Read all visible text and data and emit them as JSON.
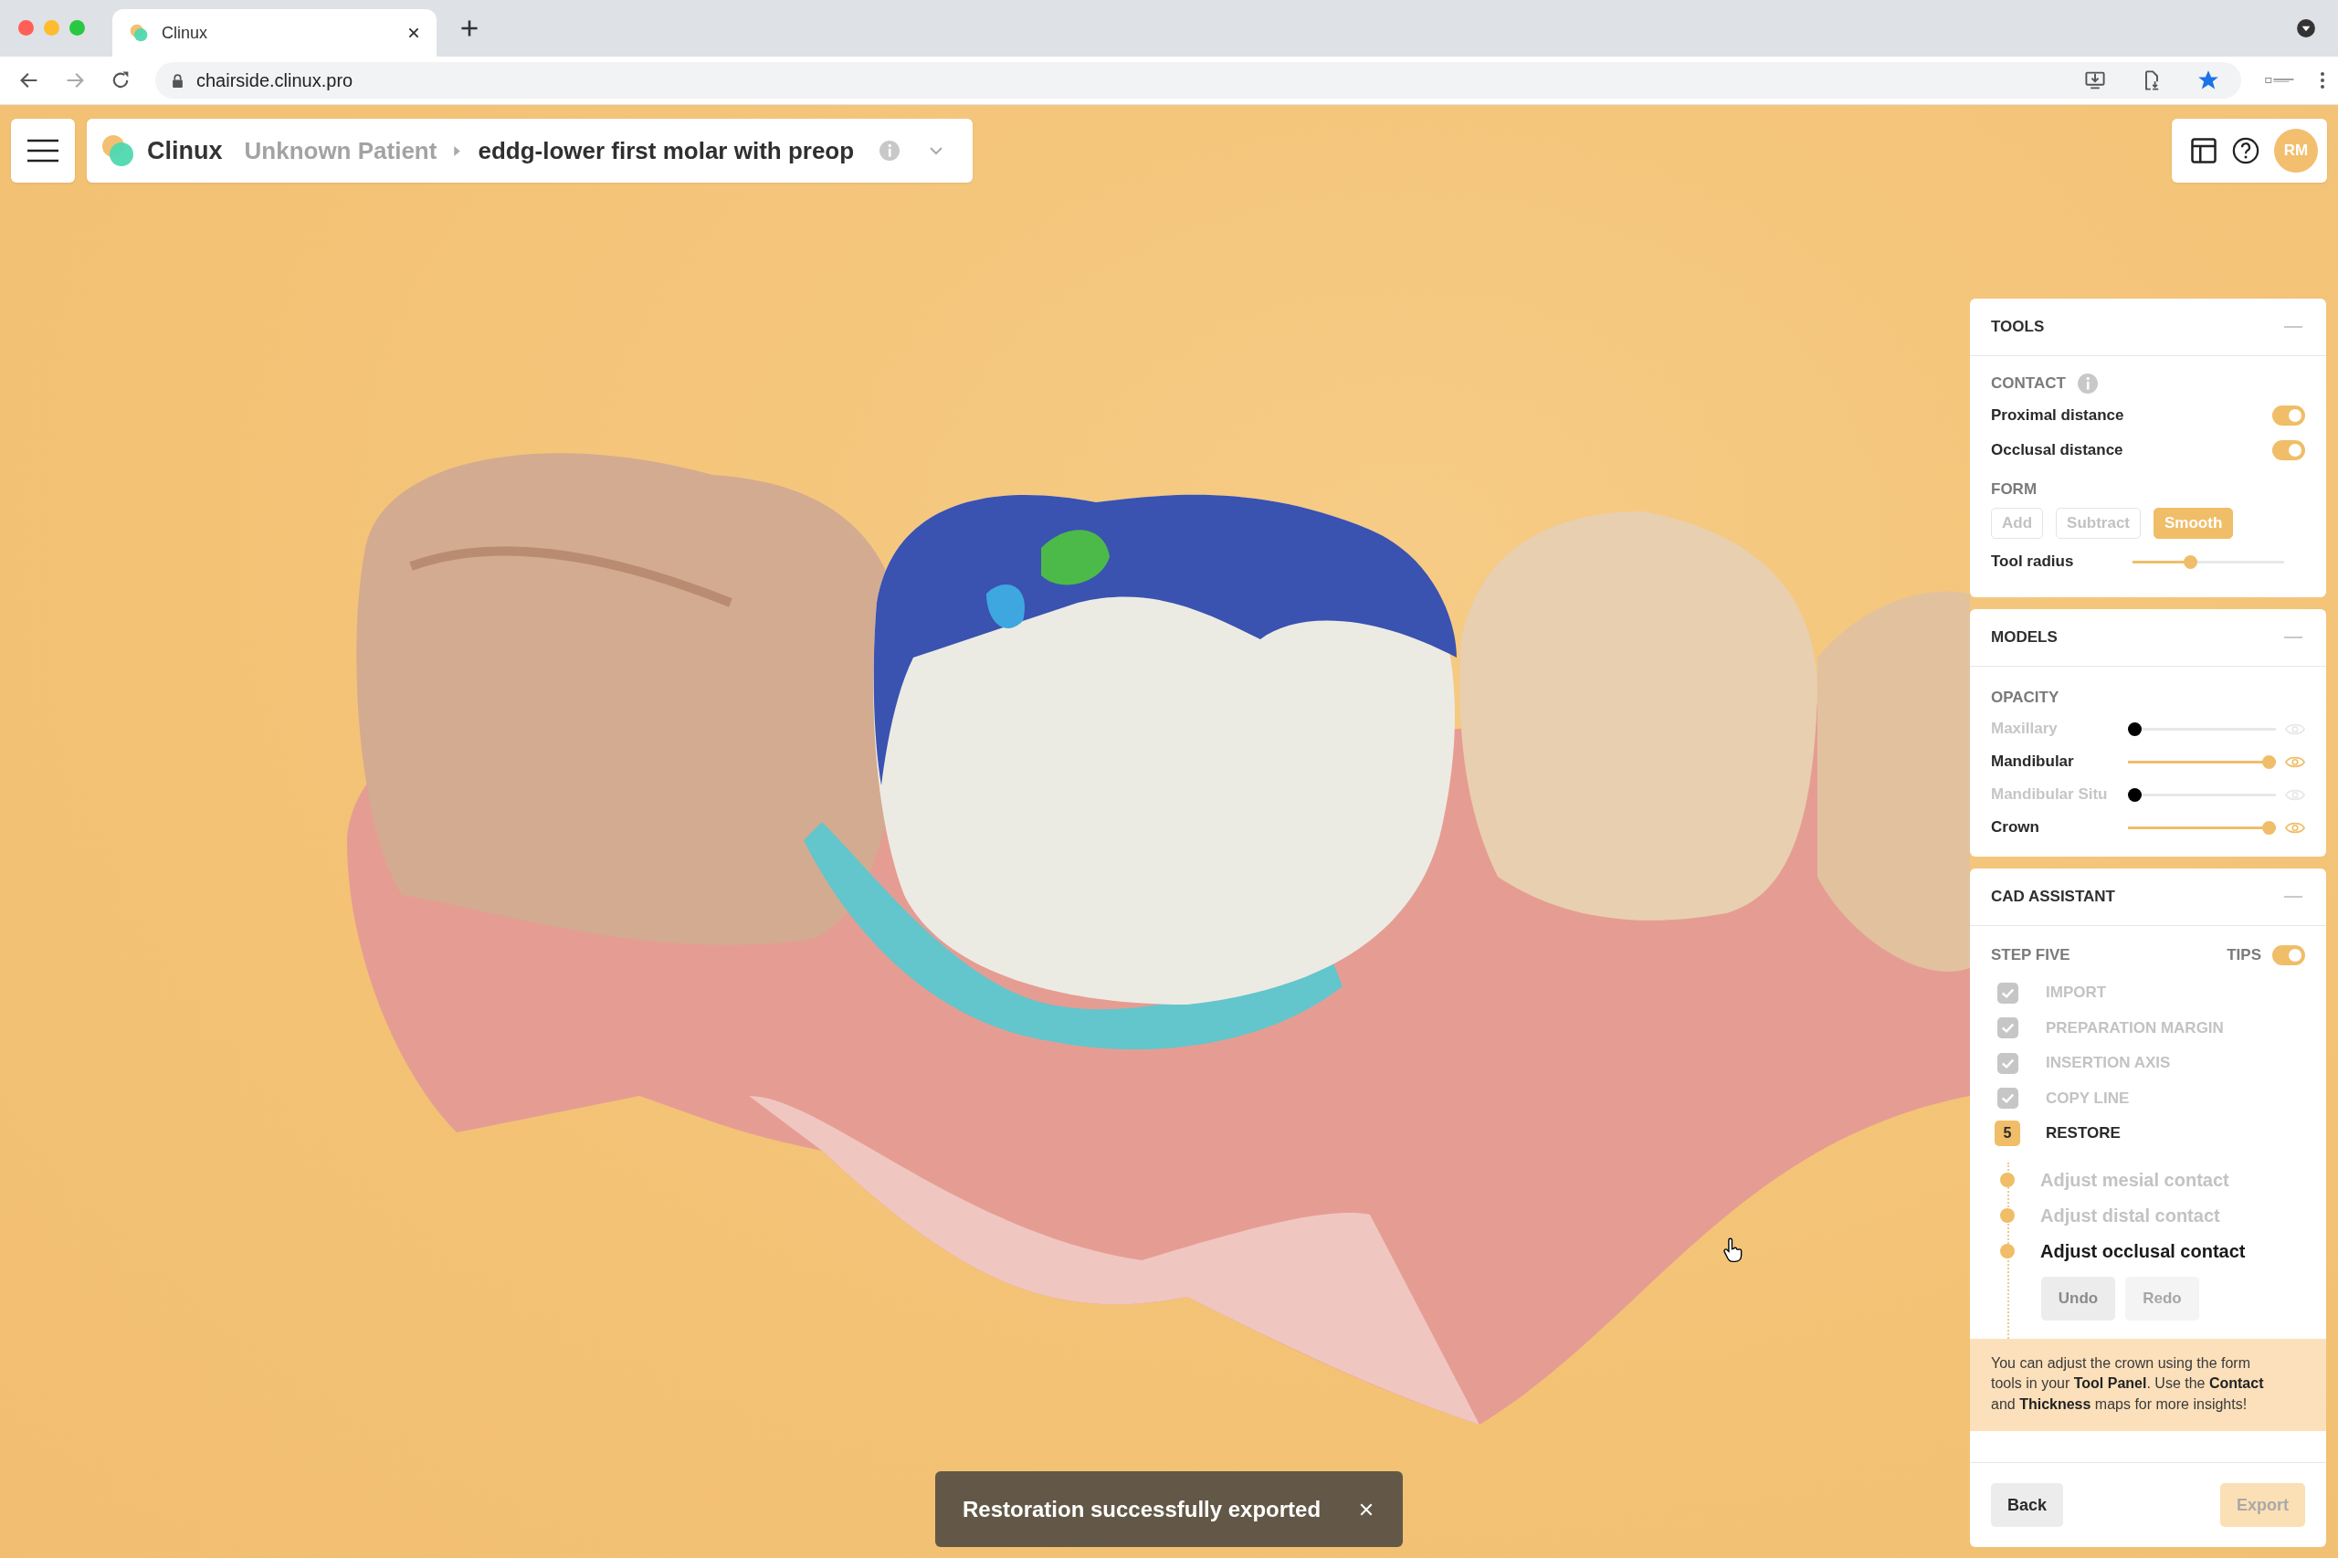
{
  "browser": {
    "tab_title": "Clinux",
    "url": "chairside.clinux.pro"
  },
  "header": {
    "app_name": "Clinux",
    "breadcrumb": [
      {
        "label": "Unknown Patient",
        "current": false
      },
      {
        "label": "eddg-lower first molar with preop",
        "current": true
      }
    ],
    "avatar_initials": "RM"
  },
  "tools_panel": {
    "title": "TOOLS",
    "contact": {
      "heading": "CONTACT",
      "toggles": [
        {
          "label": "Proximal distance",
          "on": true
        },
        {
          "label": "Occlusal distance",
          "on": true
        }
      ]
    },
    "form": {
      "heading": "FORM",
      "modes": [
        {
          "label": "Add",
          "selected": false
        },
        {
          "label": "Subtract",
          "selected": false
        },
        {
          "label": "Smooth",
          "selected": true
        }
      ],
      "tool_radius": {
        "label": "Tool radius",
        "level": 0.37
      }
    }
  },
  "models_panel": {
    "title": "MODELS",
    "heading": "OPACITY",
    "models": [
      {
        "name": "Maxillary",
        "visible": false,
        "level": 0
      },
      {
        "name": "Mandibular",
        "visible": true,
        "level": 1
      },
      {
        "name": "Mandibular Situ",
        "visible": false,
        "level": 0
      },
      {
        "name": "Crown",
        "visible": true,
        "level": 1
      }
    ]
  },
  "cad_assistant": {
    "title": "CAD ASSISTANT",
    "step_label": "STEP FIVE",
    "tips": {
      "label": "TIPS",
      "on": true
    },
    "steps": [
      {
        "kind": "done",
        "label": "IMPORT"
      },
      {
        "kind": "done",
        "label": "PREPARATION MARGIN"
      },
      {
        "kind": "done",
        "label": "INSERTION AXIS"
      },
      {
        "kind": "done",
        "label": "COPY LINE"
      },
      {
        "kind": "current",
        "number": "5",
        "label": "RESTORE"
      }
    ],
    "substeps": [
      {
        "label": "Adjust mesial contact",
        "selected": false
      },
      {
        "label": "Adjust distal contact",
        "selected": false
      },
      {
        "label": "Adjust occlusal contact",
        "selected": true
      }
    ],
    "undo": {
      "label": "Undo",
      "disabled": false
    },
    "redo": {
      "label": "Redo",
      "disabled": true
    },
    "tip": "You can adjust the crown using the form tools in your **Tool Panel**. Use the **Contact** and **Thickness** maps for more insights!",
    "back": {
      "label": "Back",
      "disabled": false
    },
    "export": {
      "label": "Export",
      "disabled": true
    }
  },
  "toast": {
    "message": "Restoration successfully exported"
  }
}
